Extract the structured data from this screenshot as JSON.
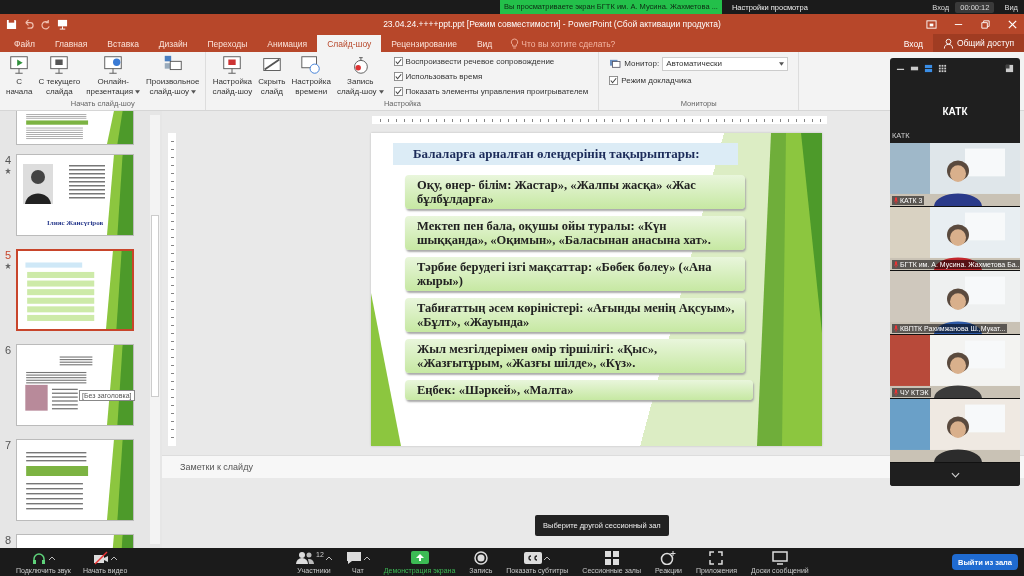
{
  "zoom_bar": {
    "banner": "Вы просматриваете экран БГТК им. А. Мусина. Жахметова ...",
    "view_options": "Настройки просмотра",
    "signin": "Вход",
    "timer": "00:00:12",
    "view": "Вид"
  },
  "window": {
    "title": "23.04.24.++++ppt.ppt [Режим совместимости] - PowerPoint (Сбой активации продукта)"
  },
  "tabs": [
    {
      "label": "Файл",
      "selected": false
    },
    {
      "label": "Главная",
      "selected": false
    },
    {
      "label": "Вставка",
      "selected": false
    },
    {
      "label": "Дизайн",
      "selected": false
    },
    {
      "label": "Переходы",
      "selected": false
    },
    {
      "label": "Анимация",
      "selected": false
    },
    {
      "label": "Слайд-шоу",
      "selected": true
    },
    {
      "label": "Рецензирование",
      "selected": false
    },
    {
      "label": "Вид",
      "selected": false
    }
  ],
  "tell_me": {
    "placeholder": "Что вы хотите сделать?"
  },
  "account": {
    "signin": "Вход",
    "share": "Общий доступ"
  },
  "ribbon": {
    "groups": [
      {
        "label": "Начать слайд-шоу",
        "buttons": [
          {
            "kind": "play",
            "lines": [
              "С",
              "начала"
            ],
            "menu": false
          },
          {
            "kind": "current",
            "lines": [
              "С текущего",
              "слайда"
            ],
            "menu": false
          },
          {
            "kind": "online",
            "lines": [
              "Онлайн-",
              "презентация"
            ],
            "menu": true
          },
          {
            "kind": "custom",
            "lines": [
              "Произвольное",
              "слайд-шоу"
            ],
            "menu": true
          }
        ]
      },
      {
        "label": "Настройка",
        "buttons": [
          {
            "kind": "setup",
            "lines": [
              "Настройка",
              "слайд-шоу"
            ],
            "menu": false
          },
          {
            "kind": "hide",
            "lines": [
              "Скрыть",
              "слайд"
            ],
            "menu": false
          },
          {
            "kind": "timing",
            "lines": [
              "Настройка",
              "времени"
            ],
            "menu": false
          },
          {
            "kind": "record",
            "lines": [
              "Запись",
              "слайд-шоу"
            ],
            "menu": true
          }
        ],
        "checkboxes": [
          {
            "label": "Воспроизвести речевое сопровождение",
            "checked": true
          },
          {
            "label": "Использовать время",
            "checked": true
          },
          {
            "label": "Показать элементы управления проигрывателем",
            "checked": true
          }
        ]
      },
      {
        "label": "Мониторы",
        "monitor": {
          "label": "Монитор:",
          "value": "Автоматически"
        },
        "checkboxes": [
          {
            "label": "Режим докладчика",
            "checked": true
          }
        ]
      }
    ]
  },
  "thumbnails": [
    {
      "kind": "text",
      "selected": false
    },
    {
      "number": "4",
      "kind": "portrait",
      "title": "Ілияс Жансүгіров",
      "selected": false
    },
    {
      "number": "5",
      "kind": "list",
      "selected": true
    },
    {
      "number": "6",
      "selected": false,
      "tooltip": "[Без заголовка]"
    },
    {
      "number": "7",
      "kind": "text",
      "selected": false
    },
    {
      "number": "8",
      "kind": "text",
      "selected": false
    }
  ],
  "slide": {
    "title": "Балаларға арналған өлеңдерінің  тақырыптары:",
    "items": [
      "Оқу, өнер- білім: Жастар», «Жалпы жасқа» «Жас бұлбұлдарға»",
      "Мектеп пен бала, оқушы ойы туралы: «Күн шыққанда», «Оқимын», «Баласынан анасына хат».",
      "Тәрбие берудегі ізгі мақсаттар: «Бөбек бөлеу» («Ана жыры»)",
      "Табиғаттың әсем көріністері: «Ағынды менің Ақсуым», «Бұлт», «Жауында»",
      "Жыл мезгілдерімен өмір тіршілігі: «Қыс», «Жазғытұрым, «Жазғы шілде», «Күз».",
      "Еңбек: «Шәркей», «Малта»"
    ]
  },
  "notes": {
    "placeholder": "Заметки к слайду"
  },
  "video_panel": {
    "heading": "КАТК",
    "section": "КАТК",
    "tiles": [
      {
        "kind": "picture",
        "name": "КАТК 3"
      },
      {
        "kind": "picture",
        "name": "БГТК им. А. Мусина. Жахметова Ба..."
      },
      {
        "kind": "picture",
        "name": "КВПТК Рахимжанова Ш.,Мукат..."
      },
      {
        "kind": "picture",
        "name": "ЧУ КТЭК"
      },
      {
        "kind": "picture"
      }
    ]
  },
  "toolbar": {
    "left": [
      {
        "kind": "audio",
        "label": "Подключить звук",
        "menu": true
      },
      {
        "kind": "video",
        "label": "Начать видео",
        "menu": true
      }
    ],
    "center": [
      {
        "kind": "participants",
        "label": "Участники",
        "count": "12",
        "menu": true,
        "active": false
      },
      {
        "kind": "chat",
        "label": "Чат",
        "menu": true,
        "active": false
      },
      {
        "kind": "share",
        "label": "Демонстрация экрана",
        "menu": false,
        "active": true
      },
      {
        "kind": "record",
        "label": "Запись",
        "menu": false,
        "active": false
      },
      {
        "kind": "cc",
        "label": "Показать субтитры",
        "menu": true,
        "active": false
      },
      {
        "kind": "rooms",
        "label": "Сессионные залы",
        "menu": false,
        "active": false
      },
      {
        "kind": "reactions",
        "label": "Реакции",
        "menu": false,
        "active": false
      },
      {
        "kind": "apps",
        "label": "Приложения",
        "menu": false,
        "active": false
      },
      {
        "kind": "board",
        "label": "Доски сообщений",
        "menu": false,
        "active": false
      }
    ],
    "leave": "Выйти из зала",
    "tooltip": "Выберите другой сессионный зал"
  }
}
